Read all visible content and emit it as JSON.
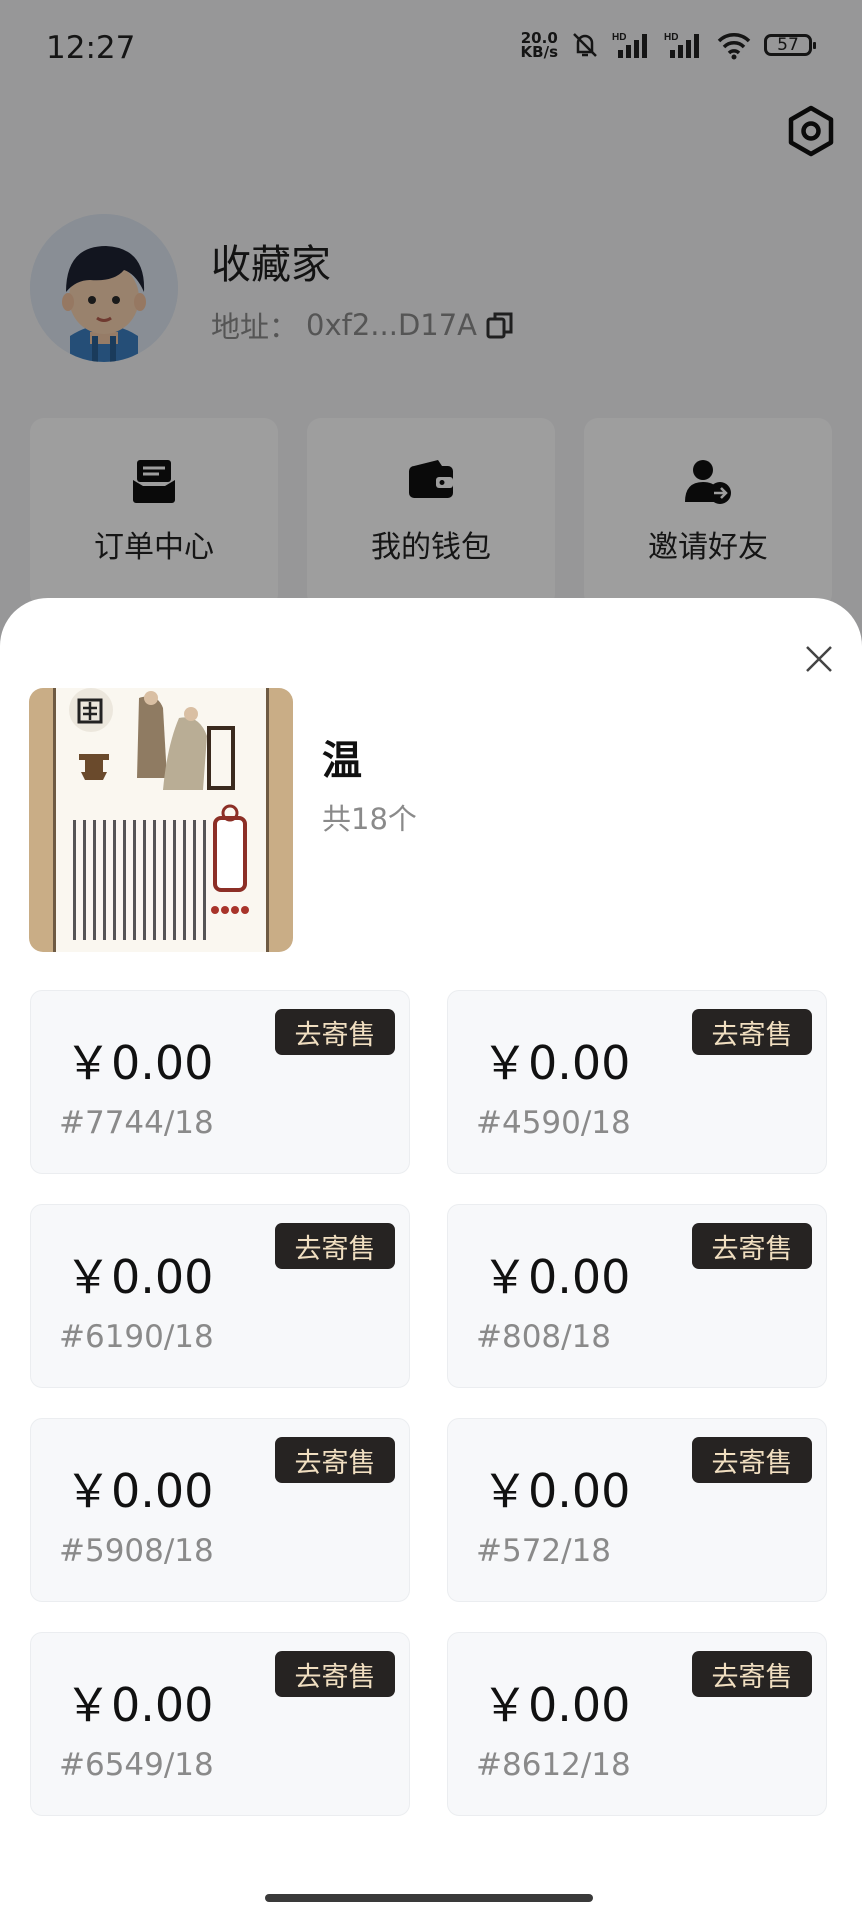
{
  "status_bar": {
    "time": "12:27",
    "net_speed_value": "20.0",
    "net_speed_unit": "KB/s",
    "signal_label_1": "HD",
    "signal_label_2": "HD",
    "battery": "57"
  },
  "profile": {
    "name": "收藏家",
    "address_label": "地址：",
    "address": "0xf2...D17A"
  },
  "quick_menu": [
    {
      "label": "订单中心",
      "icon": "mail-tray-icon"
    },
    {
      "label": "我的钱包",
      "icon": "wallet-icon"
    },
    {
      "label": "邀请好友",
      "icon": "add-user-icon"
    }
  ],
  "sheet": {
    "title": "温",
    "count": "共18个",
    "items": [
      {
        "price": "￥0.00",
        "serial": "#7744/18",
        "action": "去寄售"
      },
      {
        "price": "￥0.00",
        "serial": "#4590/18",
        "action": "去寄售"
      },
      {
        "price": "￥0.00",
        "serial": "#6190/18",
        "action": "去寄售"
      },
      {
        "price": "￥0.00",
        "serial": "#808/18",
        "action": "去寄售"
      },
      {
        "price": "￥0.00",
        "serial": "#5908/18",
        "action": "去寄售"
      },
      {
        "price": "￥0.00",
        "serial": "#572/18",
        "action": "去寄售"
      },
      {
        "price": "￥0.00",
        "serial": "#6549/18",
        "action": "去寄售"
      },
      {
        "price": "￥0.00",
        "serial": "#8612/18",
        "action": "去寄售"
      }
    ]
  },
  "colors": {
    "consign_button_bg": "#262322",
    "consign_button_text": "#f0dec0",
    "overlay": "rgba(0,0,0,0.38)"
  }
}
